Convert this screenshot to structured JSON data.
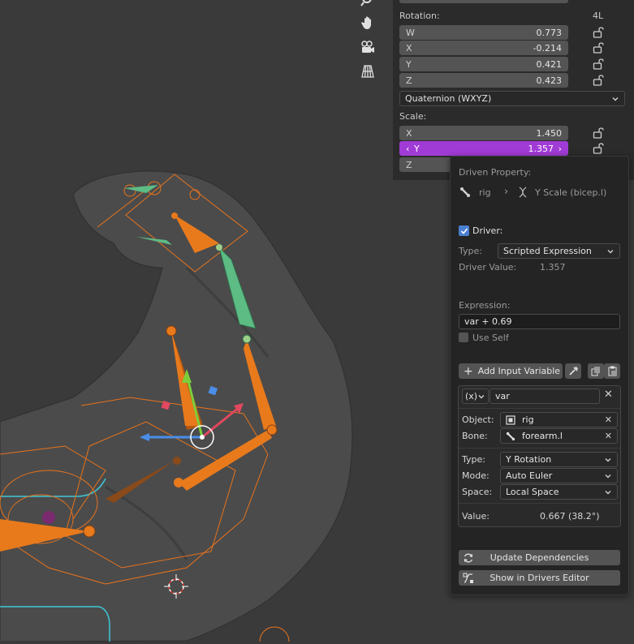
{
  "transform": {
    "rotation_label": "Rotation:",
    "rotation_mode_badge": "4L",
    "rotation": [
      {
        "axis": "W",
        "value": "0.773"
      },
      {
        "axis": "X",
        "value": "-0.214"
      },
      {
        "axis": "Y",
        "value": "0.421"
      },
      {
        "axis": "Z",
        "value": "0.423"
      }
    ],
    "rotation_mode": "Quaternion (WXYZ)",
    "scale_label": "Scale:",
    "scale": [
      {
        "axis": "X",
        "value": "1.450"
      },
      {
        "axis": "Y",
        "value": "1.357"
      },
      {
        "axis": "Z",
        "value": ""
      }
    ]
  },
  "driver_popover": {
    "driven_property_label": "Driven Property:",
    "path_object": "rig",
    "path_property": "Y Scale (bicep.l)",
    "driver_checkbox_label": "Driver:",
    "type_label": "Type:",
    "type_value": "Scripted Expression",
    "driver_value_label": "Driver Value:",
    "driver_value": "1.357",
    "expression_label": "Expression:",
    "expression": "var + 0.69",
    "use_self_label": "Use Self",
    "add_input_variable": "Add Input Variable",
    "variable": {
      "type_badge": "(x)",
      "name": "var",
      "object_label": "Object:",
      "object_value": "rig",
      "bone_label": "Bone:",
      "bone_value": "forearm.l",
      "type_label": "Type:",
      "type_value": "Y Rotation",
      "mode_label": "Mode:",
      "mode_value": "Auto Euler",
      "space_label": "Space:",
      "space_value": "Local Space",
      "value_label": "Value:",
      "value": "0.667 (38.2°)"
    },
    "update_dependencies": "Update Dependencies",
    "show_in_drivers_editor": "Show in Drivers Editor"
  },
  "colors": {
    "accent_active_field": "#a13bd6",
    "bone_orange": "#e87a1c",
    "bone_selected_green": "#5dbb84",
    "panel_bg": "#2b2b2b"
  }
}
